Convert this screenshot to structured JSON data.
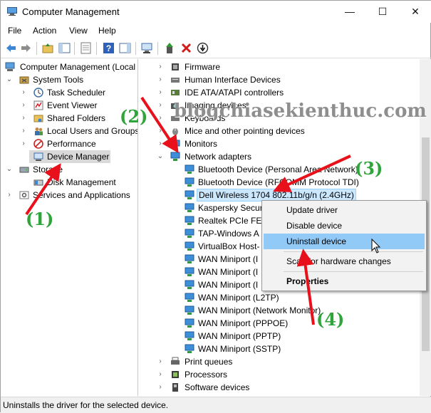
{
  "window": {
    "title": "Computer Management",
    "controls": {
      "minimize": "—",
      "maximize": "☐",
      "close": "✕"
    }
  },
  "menu": [
    "File",
    "Action",
    "View",
    "Help"
  ],
  "left_tree": {
    "root": "Computer Management (Local",
    "system_tools": "System Tools",
    "task_scheduler": "Task Scheduler",
    "event_viewer": "Event Viewer",
    "shared_folders": "Shared Folders",
    "local_users": "Local Users and Groups",
    "performance": "Performance",
    "device_manager": "Device Manager",
    "storage": "Storage",
    "disk_management": "Disk Management",
    "services": "Services and Applications"
  },
  "devices": {
    "firmware": "Firmware",
    "hid": "Human Interface Devices",
    "ide": "IDE ATA/ATAPI controllers",
    "imaging": "Imaging devices",
    "keyboards": "Keyboards",
    "mice": "Mice and other pointing devices",
    "monitors": "Monitors",
    "network_adapters": "Network adapters",
    "adapters": [
      "Bluetooth Device (Personal Area Network)",
      "Bluetooth Device (RFCOMM Protocol TDI)",
      "Dell Wireless 1704 802.11b/g/n (2.4GHz)",
      "Kaspersky Securi",
      "Realtek PCIe FE F",
      "TAP-Windows A",
      "VirtualBox Host-",
      "WAN Miniport (I",
      "WAN Miniport (I",
      "WAN Miniport (I",
      "WAN Miniport (L2TP)",
      "WAN Miniport (Network Monitor)",
      "WAN Miniport (PPPOE)",
      "WAN Miniport (PPTP)",
      "WAN Miniport (SSTP)"
    ],
    "print_queues": "Print queues",
    "processors": "Processors",
    "software_devices": "Software devices"
  },
  "context_menu": {
    "update_driver": "Update driver",
    "disable_device": "Disable device",
    "uninstall_device": "Uninstall device",
    "scan_hardware": "Scan for hardware changes",
    "properties": "Properties"
  },
  "status": "Uninstalls the driver for the selected device.",
  "annotations": {
    "watermark": "blogchiasekienthuc.com",
    "step1": "(1)",
    "step2": "(2)",
    "step3": "(3)",
    "step4": "(4)",
    "arrow_color": "#e8101a",
    "step_color": "#2ea43b"
  }
}
